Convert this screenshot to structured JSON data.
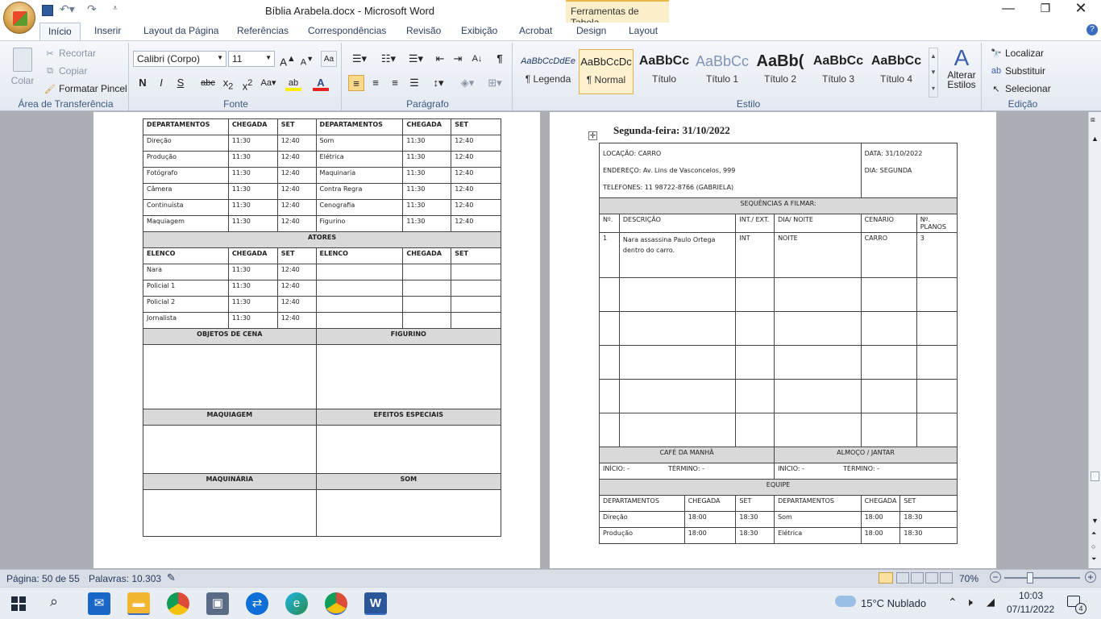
{
  "window": {
    "title": "Bíblia Arabela.docx - Microsoft Word",
    "context_tab": "Ferramentas de Tabela"
  },
  "tabs": [
    "Início",
    "Inserir",
    "Layout da Página",
    "Referências",
    "Correspondências",
    "Revisão",
    "Exibição",
    "Acrobat",
    "Design",
    "Layout"
  ],
  "clipboard": {
    "paste": "Colar",
    "cut": "Recortar",
    "copy": "Copiar",
    "format_painter": "Formatar Pincel",
    "label": "Área de Transferência"
  },
  "font": {
    "name": "Calibri (Corpo)",
    "size": "11",
    "label": "Fonte"
  },
  "paragraph": {
    "label": "Parágrafo"
  },
  "styles": {
    "label": "Estilo",
    "change": "Alterar Estilos",
    "items": [
      {
        "sample": "AaBbCcDdEe",
        "name": "¶ Legenda"
      },
      {
        "sample": "AaBbCcDc",
        "name": "¶ Normal"
      },
      {
        "sample": "AaBbCc",
        "name": "Título"
      },
      {
        "sample": "AaBbCc",
        "name": "Título 1"
      },
      {
        "sample": "AaBb(",
        "name": "Título 2"
      },
      {
        "sample": "AaBbCc",
        "name": "Título 3"
      },
      {
        "sample": "AaBbCc",
        "name": "Título 4"
      }
    ]
  },
  "editing": {
    "find": "Localizar",
    "replace": "Substituir",
    "select": "Selecionar",
    "label": "Edição"
  },
  "left_page": {
    "headers": [
      "DEPARTAMENTOS",
      "CHEGADA",
      "SET",
      "DEPARTAMENTOS",
      "CHEGADA",
      "SET"
    ],
    "dept_rows": [
      [
        "Direção",
        "11:30",
        "12:40",
        "Som",
        "11:30",
        "12:40"
      ],
      [
        "Produção",
        "11:30",
        "12:40",
        "Elétrica",
        "11:30",
        "12:40"
      ],
      [
        "Fotógrafo",
        "11:30",
        "12:40",
        "Maquinaria",
        "11:30",
        "12:40"
      ],
      [
        "Câmera",
        "11:30",
        "12:40",
        "Contra Regra",
        "11:30",
        "12:40"
      ],
      [
        "Continuísta",
        "11:30",
        "12:40",
        "Cenografia",
        "11:30",
        "12:40"
      ],
      [
        "Maquiagem",
        "11:30",
        "12:40",
        "Figurino",
        "11:30",
        "12:40"
      ]
    ],
    "actors_title": "ATORES",
    "cast_headers": [
      "ELENCO",
      "CHEGADA",
      "SET",
      "ELENCO",
      "CHEGADA",
      "SET"
    ],
    "cast_rows": [
      [
        "Nara",
        "11:30",
        "12:40",
        "",
        "",
        ""
      ],
      [
        "Policial 1",
        "11:30",
        "12:40",
        "",
        "",
        ""
      ],
      [
        "Policial 2",
        "11:30",
        "12:40",
        "",
        "",
        ""
      ],
      [
        "Jornalista",
        "11:30",
        "12:40",
        "",
        "",
        ""
      ]
    ],
    "sections": [
      [
        "OBJETOS DE CENA",
        "FIGURINO"
      ],
      [
        "MAQUIAGEM",
        "EFEITOS  ESPECIAIS"
      ],
      [
        "MAQUINÁRIA",
        "SOM"
      ]
    ]
  },
  "right_page": {
    "heading": "Segunda-feira: 31/10/2022",
    "location": "LOCAÇÃO: CARRO",
    "address": "ENDEREÇO: Av. Lins de Vasconcelos, 999",
    "phones": "TELEFONES: 11 98722-8766  (GABRIELA)",
    "date": "DATA: 31/10/2022",
    "day": "DIA: SEGUNDA",
    "seq_title": "SEQUÊNCIAS A FILMAR:",
    "seq_headers": [
      "Nº.",
      "DESCRIÇÃO",
      "INT./ EXT.",
      "DIA/ NOITE",
      "CENÁRIO",
      "Nº. PLANOS"
    ],
    "seq_row": [
      "1",
      "Nara assassina Paulo Ortega dentro do carro.",
      "INT",
      "NOITE",
      "CARRO",
      "3"
    ],
    "breakfast": "CAFÉ DA MANHÃ",
    "lunch": "ALMOÇO / JANTAR",
    "start": "INÍCIO: -",
    "end": "TÉRMINO: -",
    "team": "EQUIPE",
    "team_headers": [
      "DEPARTAMENTOS",
      "CHEGADA",
      "SET",
      "DEPARTAMENTOS",
      "CHEGADA",
      "SET"
    ],
    "team_rows": [
      [
        "Direção",
        "18:00",
        "18:30",
        "Som",
        "18:00",
        "18:30"
      ],
      [
        "Produção",
        "18:00",
        "18:30",
        "Elétrica",
        "18:00",
        "18:30"
      ]
    ]
  },
  "status": {
    "page": "Página: 50 de 55",
    "words": "Palavras: 10.303",
    "zoom": "70%"
  },
  "taskbar": {
    "weather": "15°C  Nublado",
    "time": "10:03",
    "date": "07/11/2022",
    "notif": "4"
  }
}
